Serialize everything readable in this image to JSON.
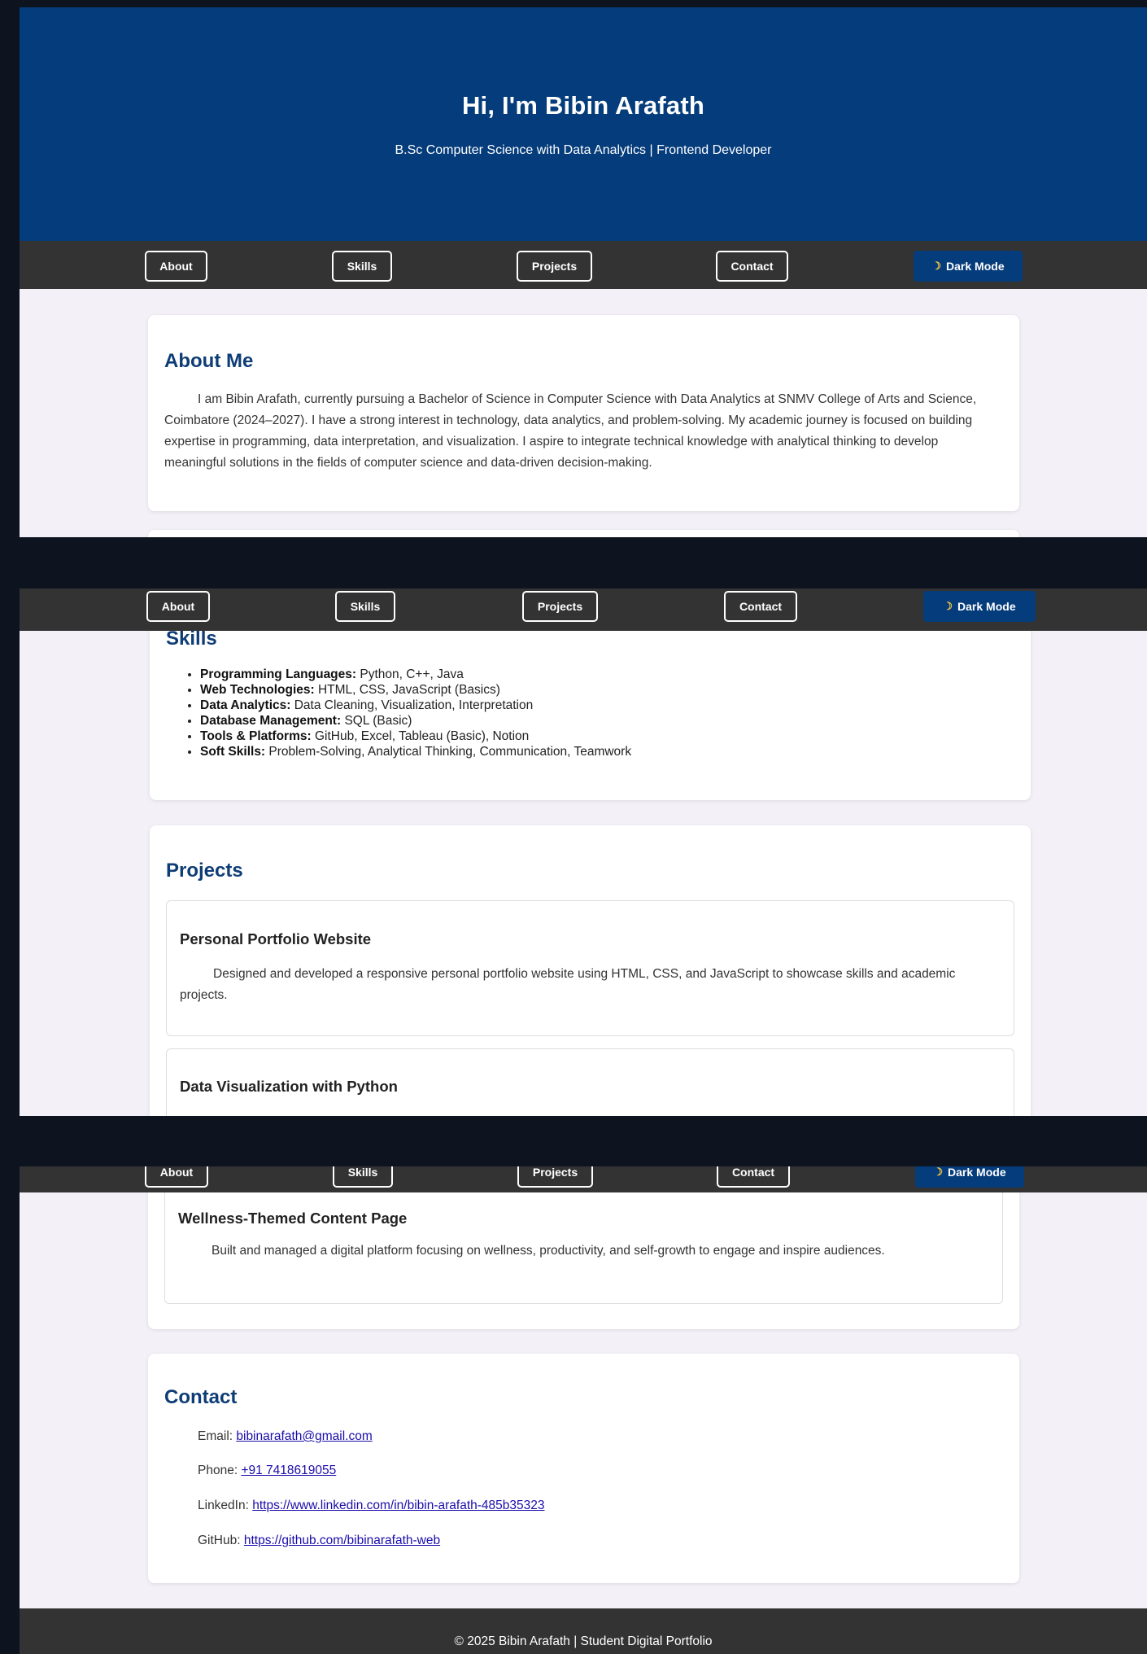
{
  "hero": {
    "title": "Hi, I'm Bibin Arafath",
    "subtitle": "B.Sc Computer Science with Data Analytics | Frontend Developer"
  },
  "nav": {
    "about": "About",
    "skills": "Skills",
    "projects": "Projects",
    "contact": "Contact",
    "dark_mode": "Dark Mode",
    "moon_icon": "moon-icon"
  },
  "about": {
    "title": "About Me",
    "text": "I am Bibin Arafath, currently pursuing a Bachelor of Science in Computer Science with Data Analytics at SNMV College of Arts and Science, Coimbatore (2024–2027). I have a strong interest in technology, data analytics, and problem-solving. My academic journey is focused on building expertise in programming, data interpretation, and visualization. I aspire to integrate technical knowledge with analytical thinking to develop meaningful solutions in the fields of computer science and data-driven decision-making."
  },
  "skills": {
    "title": "Skills",
    "items": [
      {
        "label": "Programming Languages:",
        "value": " Python, C++, Java"
      },
      {
        "label": "Web Technologies:",
        "value": " HTML, CSS, JavaScript (Basics)"
      },
      {
        "label": "Data Analytics:",
        "value": " Data Cleaning, Visualization, Interpretation"
      },
      {
        "label": "Database Management:",
        "value": " SQL (Basic)"
      },
      {
        "label": "Tools & Platforms:",
        "value": " GitHub, Excel, Tableau (Basic), Notion"
      },
      {
        "label": "Soft Skills:",
        "value": " Problem-Solving, Analytical Thinking, Communication, Teamwork"
      }
    ]
  },
  "projects": {
    "title": "Projects",
    "items": [
      {
        "title": "Personal Portfolio Website",
        "desc": "Designed and developed a responsive personal portfolio website using HTML, CSS, and JavaScript to showcase skills and academic projects."
      },
      {
        "title": "Data Visualization with Python",
        "desc": ""
      },
      {
        "title": "Wellness-Themed Content Page",
        "desc": "Built and managed a digital platform focusing on wellness, productivity, and self-growth to engage and inspire audiences."
      }
    ]
  },
  "contact": {
    "title": "Contact",
    "email_label": "Email: ",
    "email": "bibinarafath@gmail.com",
    "phone_label": "Phone: ",
    "phone": "+91 7418619055",
    "linkedin_label": "LinkedIn: ",
    "linkedin": "https://www.linkedin.com/in/bibin-arafath-485b35323",
    "github_label": "GitHub: ",
    "github": "https://github.com/bibinarafath-web"
  },
  "footer": {
    "text": "© 2025 Bibin Arafath | Student Digital Portfolio"
  }
}
